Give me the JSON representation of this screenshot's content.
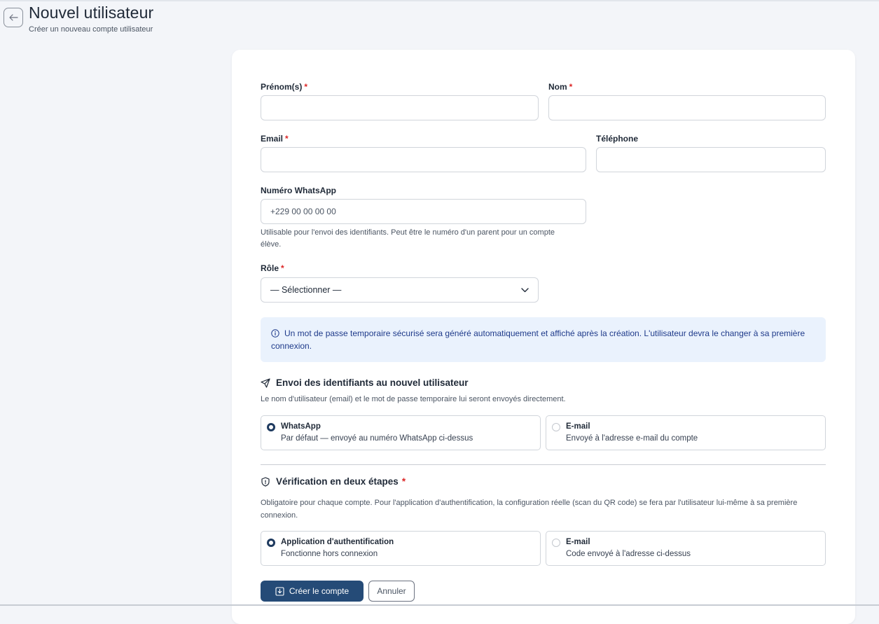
{
  "header": {
    "back_icon": "arrow-left-icon",
    "title": "Nouvel utilisateur",
    "subtitle": "Créer un nouveau compte utilisateur"
  },
  "form": {
    "first_name": {
      "label": "Prénom(s)",
      "required_mark": "*",
      "value": ""
    },
    "last_name": {
      "label": "Nom",
      "required_mark": "*",
      "value": ""
    },
    "email": {
      "label": "Email",
      "required_mark": "*",
      "value": ""
    },
    "phone": {
      "label": "Téléphone",
      "value": ""
    },
    "whatsapp": {
      "label": "Numéro WhatsApp",
      "placeholder": "+229 00 00 00 00",
      "help_line1": "Utilisable pour l'envoi des identifiants. Peut être le numéro d'un parent pour un compte",
      "help_line2": "élève."
    },
    "role": {
      "label": "Rôle",
      "required_mark": "*",
      "selected": "— Sélectionner —",
      "icon": "chevron-down-icon"
    },
    "info": {
      "icon": "info-circle-icon",
      "text": "Un mot de passe temporaire sécurisé sera généré automatiquement et affiché après la création. L'utilisateur devra le changer à sa première connexion."
    },
    "credentials": {
      "icon": "send-icon",
      "title": "Envoi des identifiants au nouvel utilisateur",
      "description": "Le nom d'utilisateur (email) et le mot de passe temporaire lui seront envoyés directement.",
      "options": [
        {
          "title": "WhatsApp",
          "description": "Par défaut — envoyé au numéro WhatsApp ci-dessus",
          "checked": true
        },
        {
          "title": "E-mail",
          "description": "Envoyé à l'adresse e-mail du compte",
          "checked": false
        }
      ]
    },
    "two_factor": {
      "icon": "shield-icon",
      "title": "Vérification en deux étapes",
      "required_mark": "*",
      "description_line1": "Obligatoire pour chaque compte. Pour l'application d'authentification, la configuration réelle (scan du QR code) se fera par l'utilisateur lui-même à sa première",
      "description_line2": "connexion.",
      "options": [
        {
          "title": "Application d'authentification",
          "description": "Fonctionne hors connexion",
          "checked": true
        },
        {
          "title": "E-mail",
          "description": "Code envoyé à l'adresse ci-dessus",
          "checked": false
        }
      ]
    },
    "actions": {
      "submit_icon": "save-icon",
      "submit_label": "Créer le compte",
      "cancel_label": "Annuler"
    }
  },
  "colors": {
    "primary": "#254b77",
    "required": "#dc2626",
    "info_bg": "#eaf2fd",
    "info_text": "#1e3a8a"
  }
}
